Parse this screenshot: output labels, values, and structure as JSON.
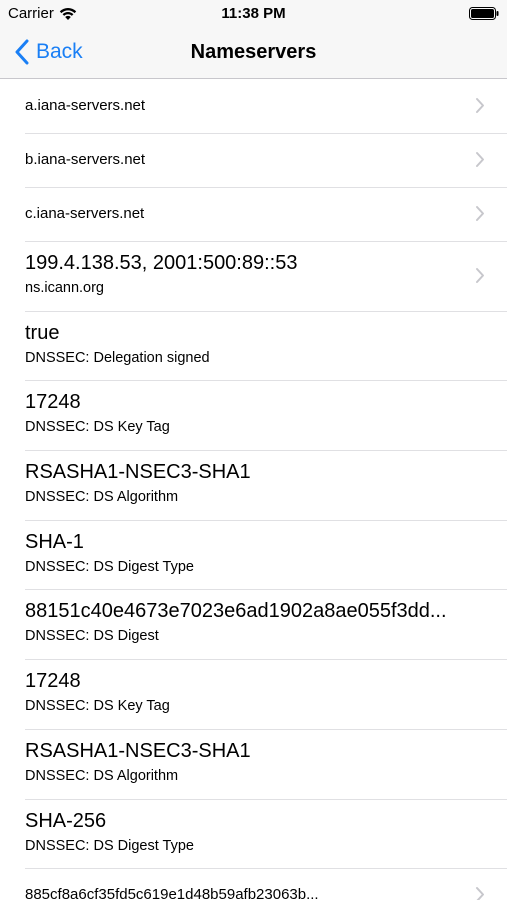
{
  "status_bar": {
    "carrier": "Carrier",
    "time": "11:38 PM"
  },
  "nav": {
    "back_label": "Back",
    "title": "Nameservers"
  },
  "colors": {
    "accent": "#1a7ff5",
    "chevron": "#c7c7cc",
    "divider": "#e0e0e3"
  },
  "rows": [
    {
      "main": "a.iana-servers.net",
      "sub": "",
      "chevron": true
    },
    {
      "main": "b.iana-servers.net",
      "sub": "",
      "chevron": true
    },
    {
      "main": "c.iana-servers.net",
      "sub": "",
      "chevron": true
    },
    {
      "main": "199.4.138.53, 2001:500:89::53",
      "sub": "ns.icann.org",
      "chevron": true
    },
    {
      "main": "true",
      "sub": "DNSSEC: Delegation signed",
      "chevron": false
    },
    {
      "main": "17248",
      "sub": "DNSSEC: DS Key Tag",
      "chevron": false
    },
    {
      "main": "RSASHA1-NSEC3-SHA1",
      "sub": "DNSSEC: DS Algorithm",
      "chevron": false
    },
    {
      "main": "SHA-1",
      "sub": "DNSSEC: DS Digest Type",
      "chevron": false
    },
    {
      "main": "88151c40e4673e7023e6ad1902a8ae055f3dd...",
      "sub": "DNSSEC: DS Digest",
      "chevron": false
    },
    {
      "main": "17248",
      "sub": "DNSSEC: DS Key Tag",
      "chevron": false
    },
    {
      "main": "RSASHA1-NSEC3-SHA1",
      "sub": "DNSSEC: DS Algorithm",
      "chevron": false
    },
    {
      "main": "SHA-256",
      "sub": "DNSSEC: DS Digest Type",
      "chevron": false
    },
    {
      "main": "885cf8a6cf35fd5c619e1d48b59afb23063b...",
      "sub": "",
      "chevron": true
    }
  ]
}
